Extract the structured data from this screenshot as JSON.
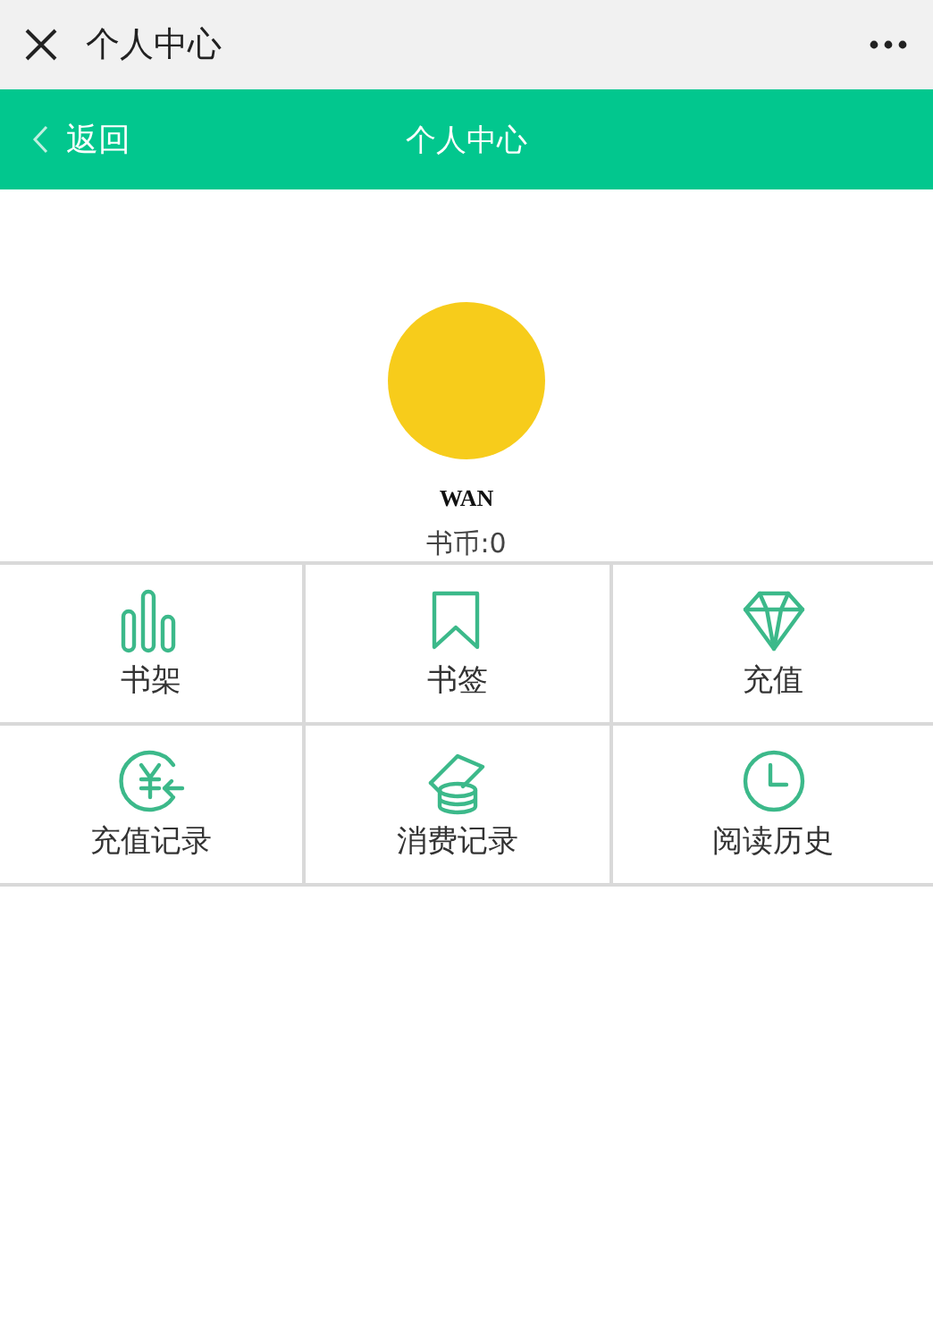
{
  "window": {
    "title": "个人中心"
  },
  "nav_bar": {
    "back": "返回",
    "title": "个人中心"
  },
  "profile": {
    "name": "WAN",
    "coins": "书币:0"
  },
  "menu": [
    {
      "label": "书架",
      "kind": "bars"
    },
    {
      "label": "书签",
      "kind": "bookmark"
    },
    {
      "label": "充值",
      "kind": "diamond"
    },
    {
      "label": "充值记录",
      "kind": "yen"
    },
    {
      "label": "消费记录",
      "kind": "coins"
    },
    {
      "label": "阅读历史",
      "kind": "clock"
    }
  ]
}
